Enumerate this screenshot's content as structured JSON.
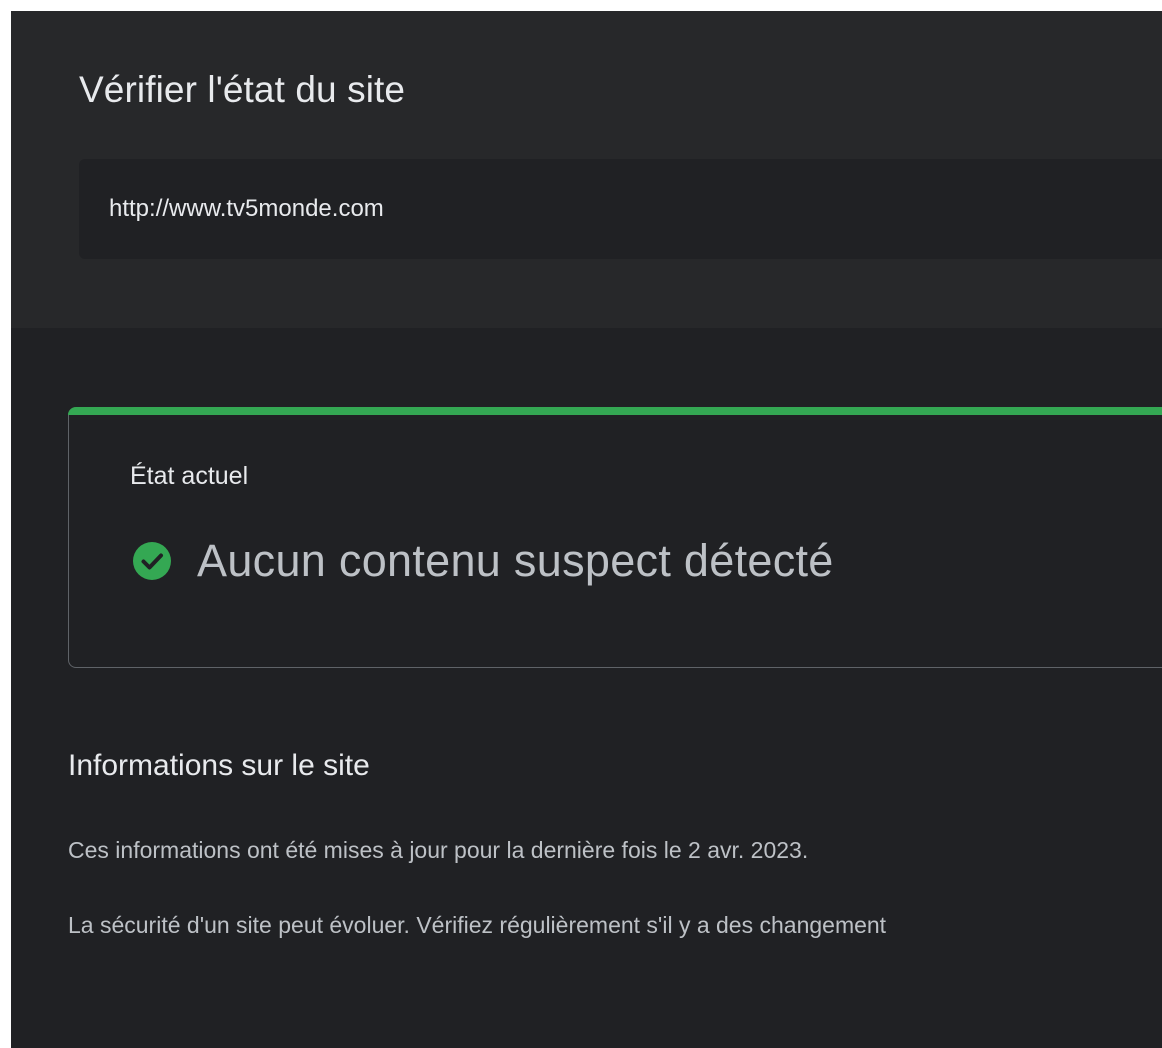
{
  "page": {
    "title": "Vérifier l'état du site"
  },
  "search": {
    "value": "http://www.tv5monde.com"
  },
  "status": {
    "caption": "État actuel",
    "text": "Aucun contenu suspect détecté",
    "icon": "check-circle-icon",
    "color": "#34a853"
  },
  "site_info": {
    "title": "Informations sur le site",
    "updated": "Ces informations ont été mises à jour pour la dernière fois le 2 avr. 2023.",
    "note": "La sécurité d'un site peut évoluer. Vérifiez régulièrement s'il y a des changement"
  },
  "colors": {
    "background": "#202124",
    "header_band": "#27282a",
    "accent_green": "#34a853",
    "text_primary": "#e8eaed",
    "text_secondary": "#bdc1c6"
  }
}
